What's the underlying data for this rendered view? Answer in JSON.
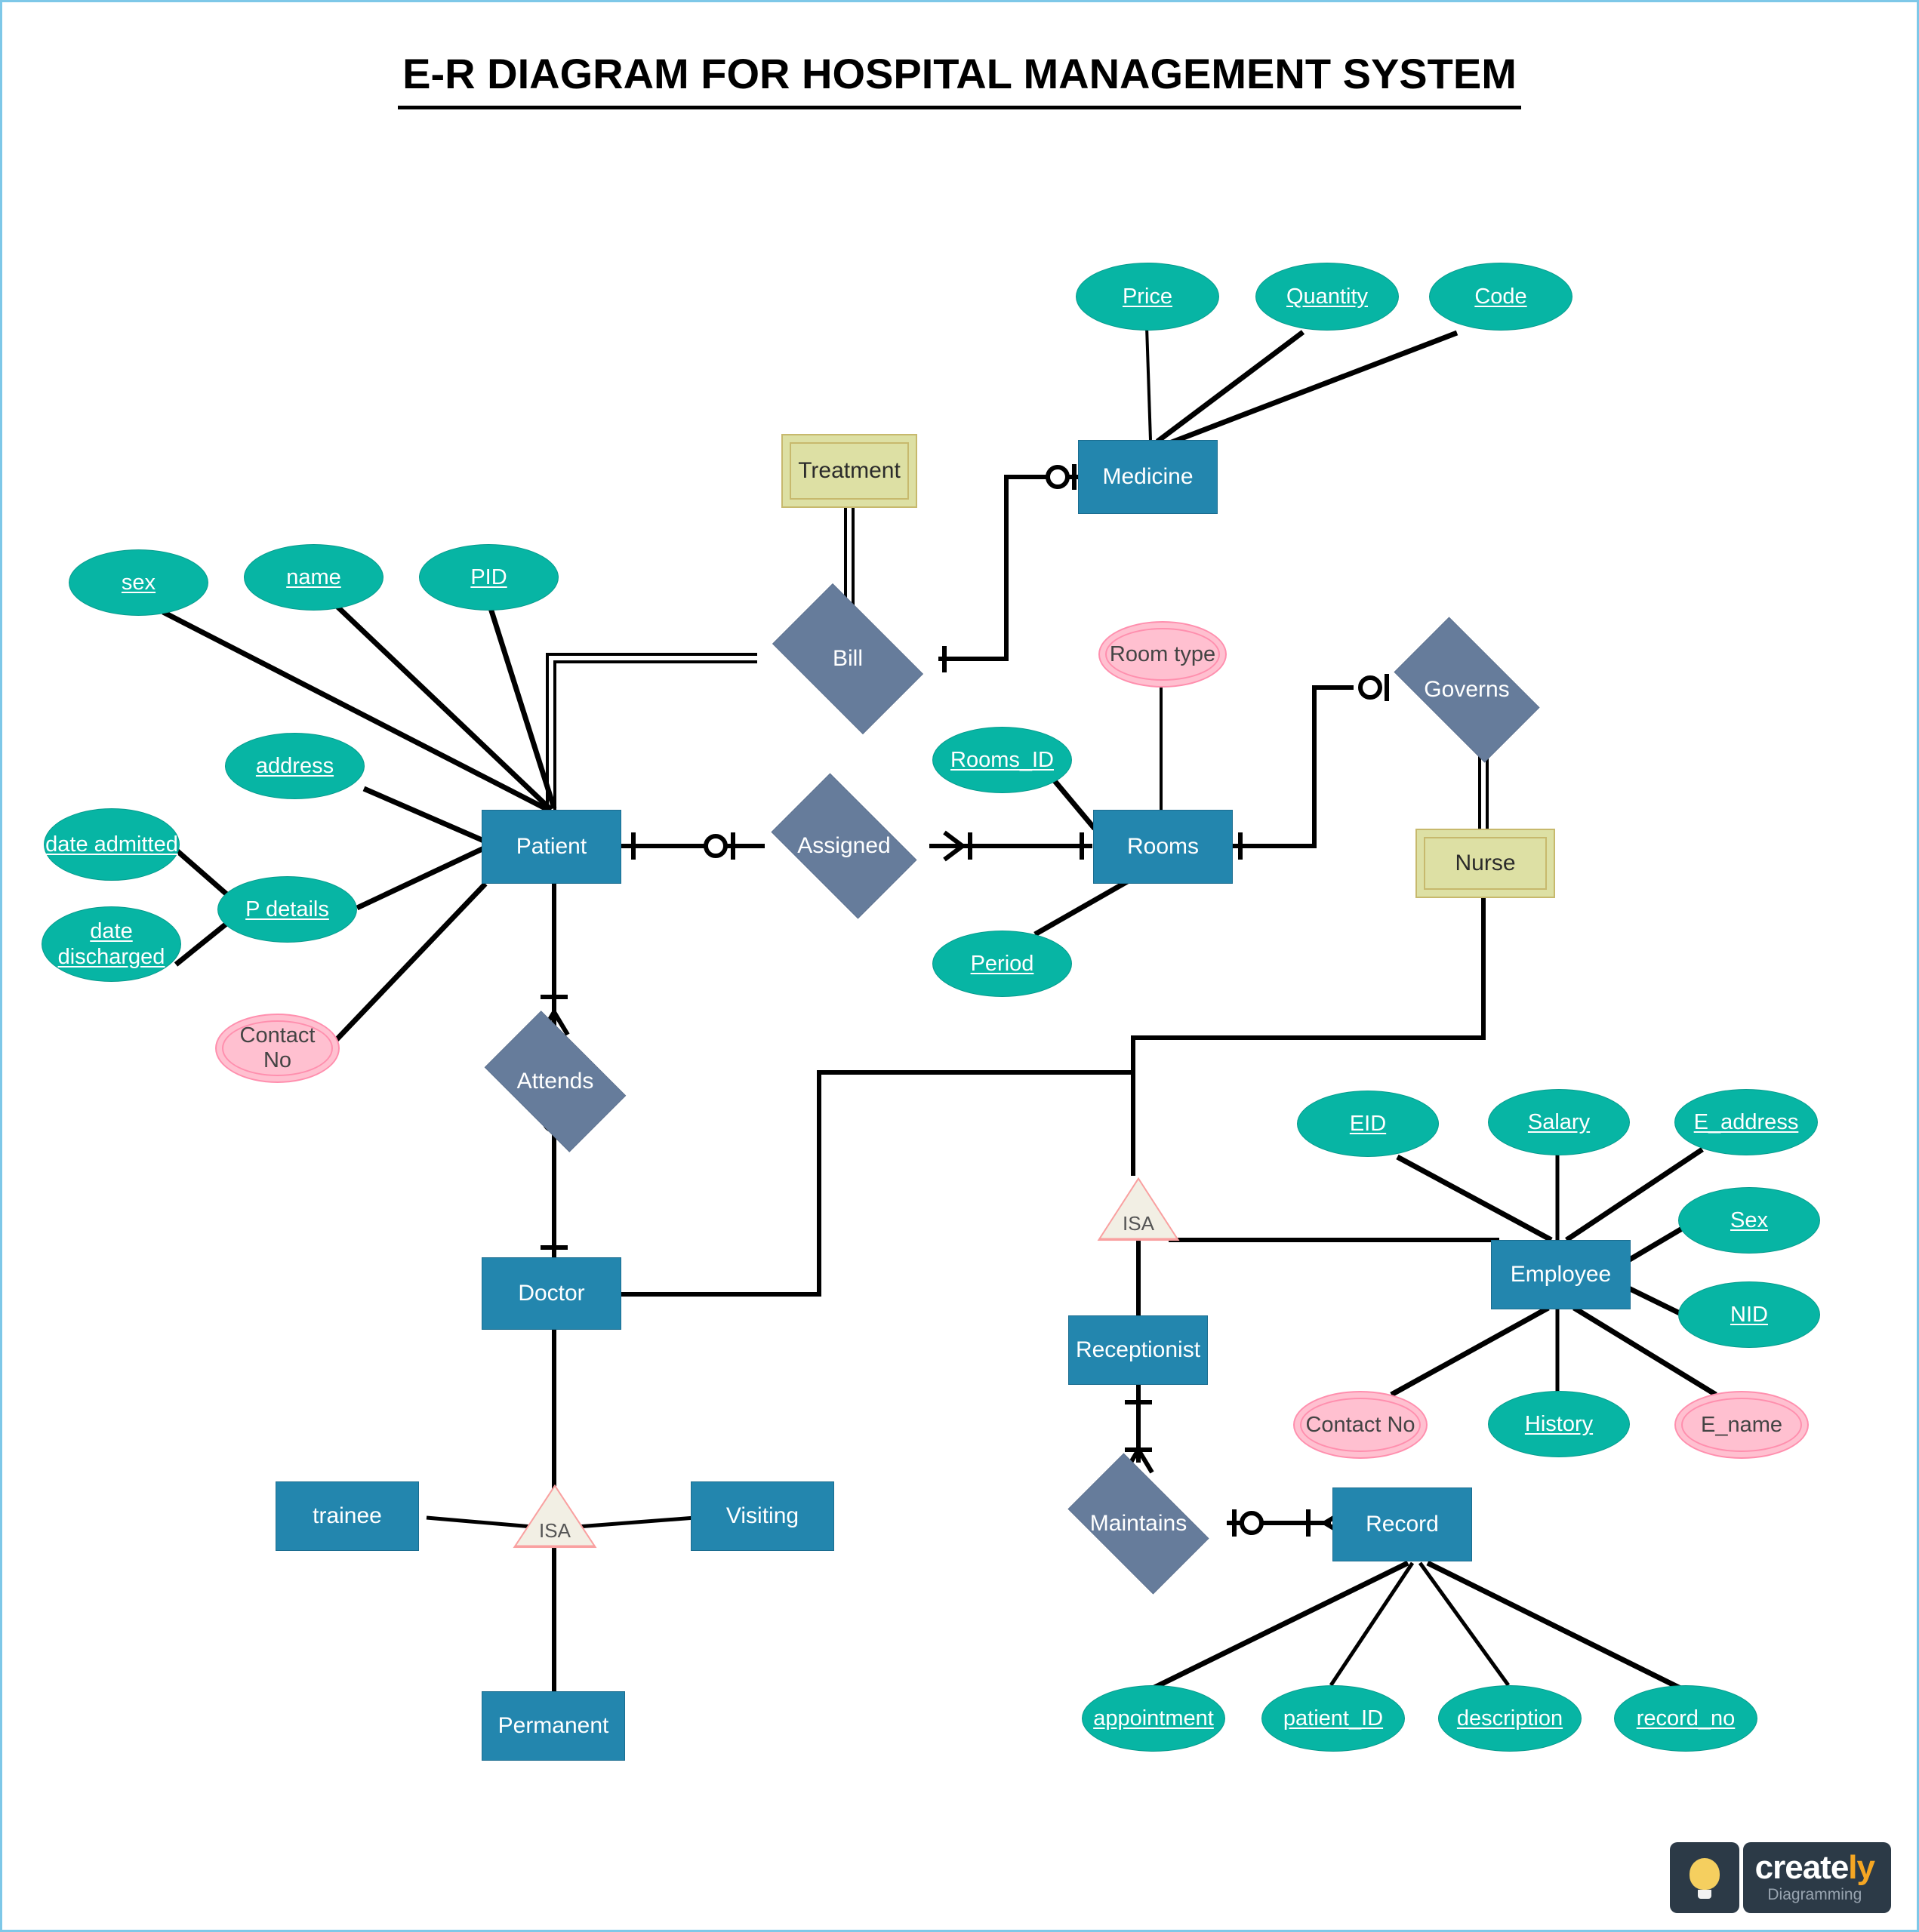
{
  "title": "E-R DIAGRAM FOR HOSPITAL MANAGEMENT SYSTEM",
  "colors": {
    "entity_fill": "#2386ae",
    "attribute_fill": "#07b5a4",
    "relationship_fill": "#667c9b",
    "weak_entity_fill": "#dde0a4",
    "multivalued_fill": "#ffc0d0",
    "isa_fill": "#f2efe4",
    "page_border": "#7ec8e8",
    "line": "#000000"
  },
  "entities": [
    {
      "id": "patient",
      "label": "Patient",
      "type": "entity"
    },
    {
      "id": "medicine",
      "label": "Medicine",
      "type": "entity"
    },
    {
      "id": "rooms",
      "label": "Rooms",
      "type": "entity"
    },
    {
      "id": "doctor",
      "label": "Doctor",
      "type": "entity"
    },
    {
      "id": "employee",
      "label": "Employee",
      "type": "entity"
    },
    {
      "id": "receptionist",
      "label": "Receptionist",
      "type": "entity"
    },
    {
      "id": "record",
      "label": "Record",
      "type": "entity"
    },
    {
      "id": "trainee",
      "label": "trainee",
      "type": "entity"
    },
    {
      "id": "visiting",
      "label": "Visiting",
      "type": "entity"
    },
    {
      "id": "permanent",
      "label": "Permanent",
      "type": "entity"
    }
  ],
  "weak_entities": [
    {
      "id": "treatment",
      "label": "Treatment"
    },
    {
      "id": "nurse",
      "label": "Nurse"
    }
  ],
  "relationships": [
    {
      "id": "bill",
      "label": "Bill"
    },
    {
      "id": "assigned",
      "label": "Assigned"
    },
    {
      "id": "governs",
      "label": "Governs"
    },
    {
      "id": "attends",
      "label": "Attends"
    },
    {
      "id": "maintains",
      "label": "Maintains"
    }
  ],
  "isa_nodes": [
    {
      "id": "isa-doctor",
      "label": "ISA"
    },
    {
      "id": "isa-employee",
      "label": "ISA"
    }
  ],
  "attributes": {
    "patient": [
      {
        "id": "sex",
        "label": "sex",
        "key": true
      },
      {
        "id": "name",
        "label": "name",
        "key": true
      },
      {
        "id": "pid",
        "label": "PID",
        "key": true
      },
      {
        "id": "address",
        "label": "address",
        "key": true
      },
      {
        "id": "p-details",
        "label": "P details",
        "key": true
      },
      {
        "id": "date-admitted",
        "label": "date admitted",
        "key": true
      },
      {
        "id": "date-discharged",
        "label": "date discharged",
        "key": true
      },
      {
        "id": "contact-no-patient",
        "label": "Contact No",
        "multivalued": true
      }
    ],
    "medicine": [
      {
        "id": "price",
        "label": "Price",
        "key": true
      },
      {
        "id": "quantity",
        "label": "Quantity",
        "key": true
      },
      {
        "id": "code",
        "label": "Code",
        "key": true
      }
    ],
    "rooms": [
      {
        "id": "rooms-id",
        "label": "Rooms_ID",
        "key": true
      },
      {
        "id": "period",
        "label": "Period",
        "key": true
      },
      {
        "id": "room-type",
        "label": "Room type",
        "multivalued": true
      }
    ],
    "employee": [
      {
        "id": "eid",
        "label": "EID",
        "key": true
      },
      {
        "id": "salary",
        "label": "Salary",
        "key": true
      },
      {
        "id": "e-address",
        "label": "E_address",
        "key": true
      },
      {
        "id": "e-sex",
        "label": "Sex",
        "key": true
      },
      {
        "id": "nid",
        "label": "NID",
        "key": true
      },
      {
        "id": "history",
        "label": "History",
        "key": true
      },
      {
        "id": "contact-no-employee",
        "label": "Contact No",
        "multivalued": true
      },
      {
        "id": "e-name",
        "label": "E_name",
        "multivalued": true
      }
    ],
    "record": [
      {
        "id": "appointment",
        "label": "appointment",
        "key": true
      },
      {
        "id": "patient-id",
        "label": "patient_ID",
        "key": true
      },
      {
        "id": "description",
        "label": "description",
        "key": true
      },
      {
        "id": "record-no",
        "label": "record_no",
        "key": true
      }
    ]
  },
  "watermark": {
    "brand_main": "create",
    "brand_accent": "ly",
    "tagline": "Diagramming"
  }
}
